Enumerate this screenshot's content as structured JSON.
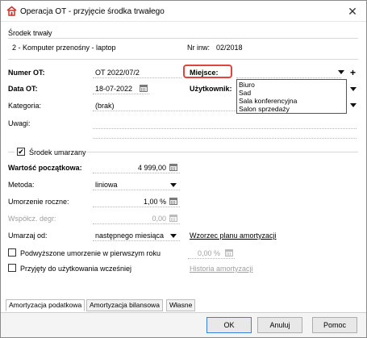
{
  "window": {
    "title": "Operacja OT - przyjęcie środka trwałego",
    "close_symbol": "✕"
  },
  "asset": {
    "section_label": "Środek trwały",
    "name": "2 - Komputer przenośny - laptop",
    "inv_label": "Nr inw:",
    "inv_value": "02/2018"
  },
  "form": {
    "numer_label": "Numer OT:",
    "numer_value": "OT 2022/07/2",
    "miejsce_label": "Miejsce:",
    "data_label": "Data OT:",
    "data_value": "18-07-2022",
    "uzytkownik_label": "Użytkownik:",
    "kategoria_label": "Kategoria:",
    "kategoria_value": "(brak)",
    "uwagi_label": "Uwagi:"
  },
  "miejsce_options": [
    "Biuro",
    "Sad",
    "Sala konferencyjna",
    "Salon sprzedaży"
  ],
  "amort": {
    "checkbox_label": "Środek umarzany",
    "checkbox_mark": "✔",
    "wartosc_label": "Wartość początkowa:",
    "wartosc_value": "4 999,00",
    "metoda_label": "Metoda:",
    "metoda_value": "liniowa",
    "umorzenie_label": "Umorzenie roczne:",
    "umorzenie_value": "1,00 %",
    "wspolcz_label": "Współcz. degr:",
    "wspolcz_value": "0,00",
    "umarzaj_label": "Umarzaj od:",
    "umarzaj_value": "następnego miesiąca",
    "wzorzec_link": "Wzorzec planu amortyzacji",
    "podwyzszone_label": "Podwyższone umorzenie w pierwszym roku",
    "podwyzszone_value": "0,00 %",
    "przyjety_label": "Przyjęty do użytkowania wcześniej",
    "historia_link": "Historia amortyzacji"
  },
  "tabs": [
    "Amortyzacja podatkowa",
    "Amortyzacja bilansowa",
    "Własne"
  ],
  "buttons": {
    "ok": "OK",
    "cancel": "Anuluj",
    "help": "Pomoc"
  },
  "colors": {
    "highlight": "#e0443e",
    "app_icon": "#c8322b",
    "ok_border": "#3c7fd6"
  }
}
